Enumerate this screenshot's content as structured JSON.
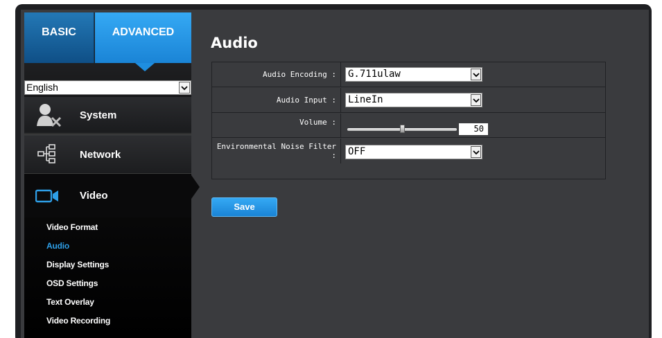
{
  "tabs": {
    "basic": "BASIC",
    "advanced": "ADVANCED"
  },
  "language": {
    "selected": "English"
  },
  "menu": {
    "system": "System",
    "network": "Network",
    "video": "Video"
  },
  "submenu": [
    "Video Format",
    "Audio",
    "Display Settings",
    "OSD Settings",
    "Text Overlay",
    "Video Recording"
  ],
  "page": {
    "title": "Audio"
  },
  "form": {
    "audio_encoding": {
      "label": "Audio Encoding :",
      "value": "G.711ulaw"
    },
    "audio_input": {
      "label": "Audio Input :",
      "value": "LineIn"
    },
    "volume": {
      "label": "Volume :",
      "value": "50",
      "level": 0.5
    },
    "noise_filter": {
      "label": "Environmental Noise Filter :",
      "value": "OFF"
    }
  },
  "buttons": {
    "save": "Save"
  },
  "colors": {
    "accent": "#1e8ee0",
    "active_submenu": "#2e9fe8"
  },
  "icons": {
    "system": "user-tools-icon",
    "network": "network-tree-icon",
    "video": "video-camera-icon"
  }
}
